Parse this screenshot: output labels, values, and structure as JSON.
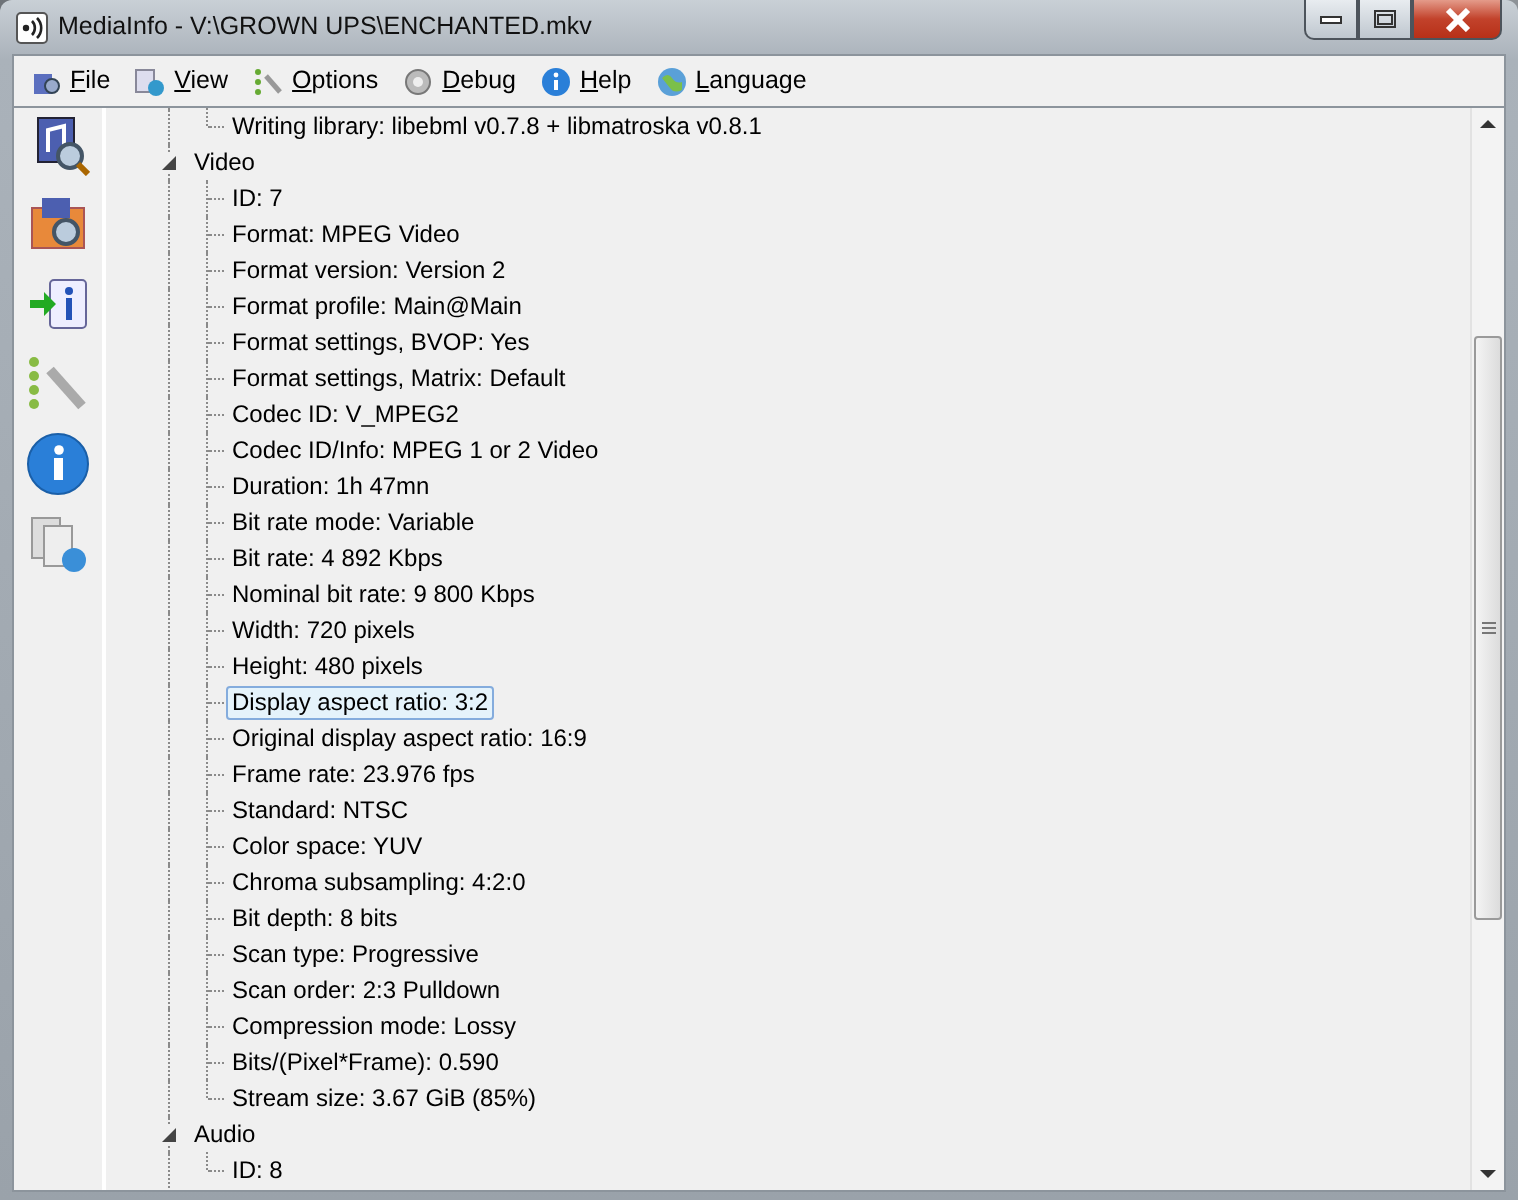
{
  "window": {
    "title": "MediaInfo - V:\\GROWN UPS\\ENCHANTED.mkv"
  },
  "menu": [
    {
      "label": "File"
    },
    {
      "label": "View"
    },
    {
      "label": "Options"
    },
    {
      "label": "Debug"
    },
    {
      "label": "Help"
    },
    {
      "label": "Language"
    }
  ],
  "tree": [
    {
      "children": [
        {
          "label": "Writing library: libebml v0.7.8 + libmatroska v0.8.1",
          "selected": false
        }
      ]
    },
    {
      "label": "Video",
      "expanded": true,
      "selected": false,
      "children": [
        {
          "label": "ID: 7",
          "selected": false
        },
        {
          "label": "Format: MPEG Video",
          "selected": false
        },
        {
          "label": "Format version: Version 2",
          "selected": false
        },
        {
          "label": "Format profile: Main@Main",
          "selected": false
        },
        {
          "label": "Format settings, BVOP: Yes",
          "selected": false
        },
        {
          "label": "Format settings, Matrix: Default",
          "selected": false
        },
        {
          "label": "Codec ID: V_MPEG2",
          "selected": false
        },
        {
          "label": "Codec ID/Info: MPEG 1 or 2 Video",
          "selected": false
        },
        {
          "label": "Duration: 1h 47mn",
          "selected": false
        },
        {
          "label": "Bit rate mode: Variable",
          "selected": false
        },
        {
          "label": "Bit rate: 4 892 Kbps",
          "selected": false
        },
        {
          "label": "Nominal bit rate: 9 800 Kbps",
          "selected": false
        },
        {
          "label": "Width: 720 pixels",
          "selected": false
        },
        {
          "label": "Height: 480 pixels",
          "selected": false
        },
        {
          "label": "Display aspect ratio: 3:2",
          "selected": true
        },
        {
          "label": "Original display aspect ratio: 16:9",
          "selected": false
        },
        {
          "label": "Frame rate: 23.976 fps",
          "selected": false
        },
        {
          "label": "Standard: NTSC",
          "selected": false
        },
        {
          "label": "Color space: YUV",
          "selected": false
        },
        {
          "label": "Chroma subsampling: 4:2:0",
          "selected": false
        },
        {
          "label": "Bit depth: 8 bits",
          "selected": false
        },
        {
          "label": "Scan type: Progressive",
          "selected": false
        },
        {
          "label": "Scan order: 2:3 Pulldown",
          "selected": false
        },
        {
          "label": "Compression mode: Lossy",
          "selected": false
        },
        {
          "label": "Bits/(Pixel*Frame): 0.590",
          "selected": false
        },
        {
          "label": "Stream size: 3.67 GiB (85%)",
          "selected": false
        }
      ]
    },
    {
      "label": "Audio",
      "expanded": true,
      "selected": false,
      "children": [
        {
          "label": "ID: 8",
          "selected": false
        }
      ]
    }
  ]
}
